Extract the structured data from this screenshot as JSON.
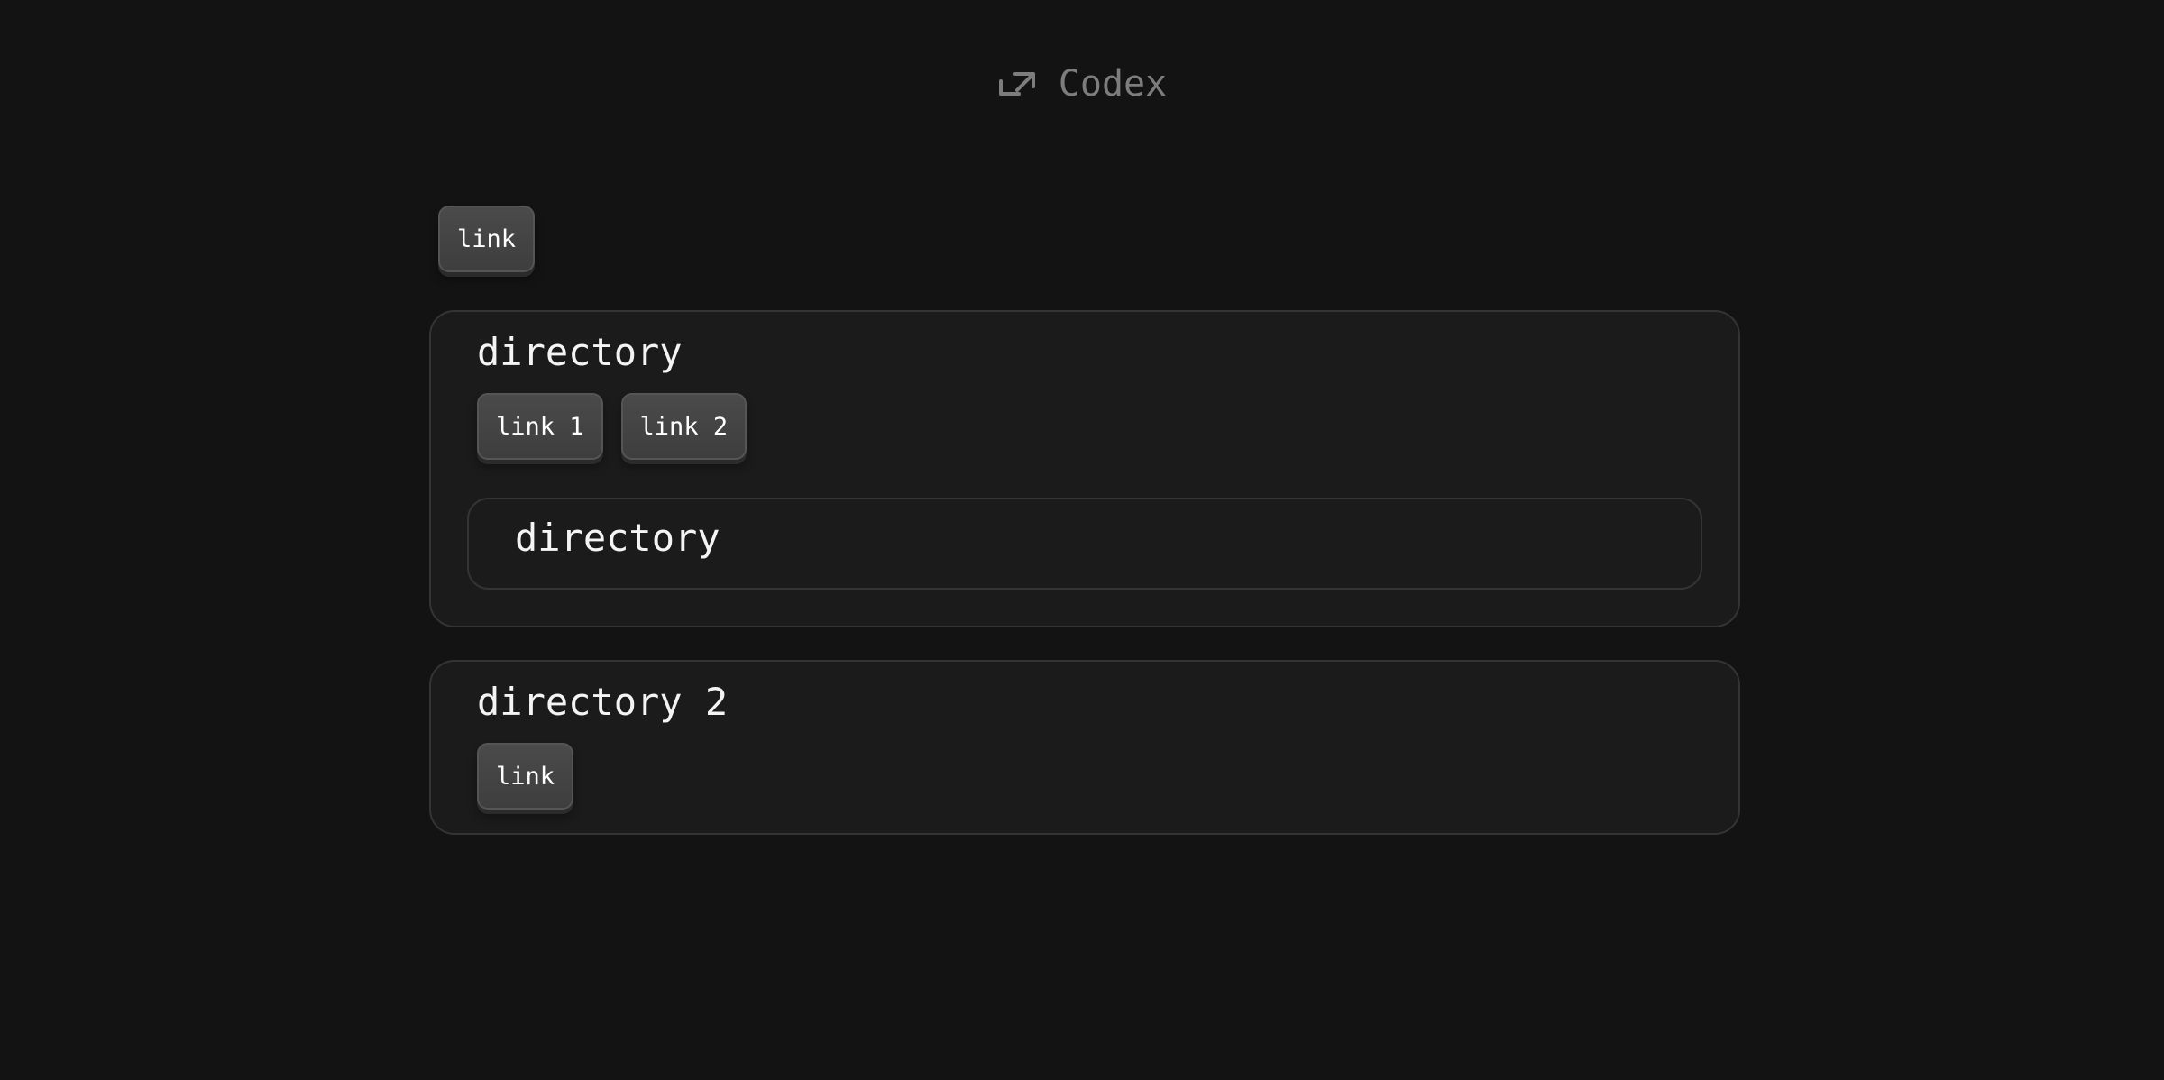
{
  "header": {
    "brand_name": "Codex",
    "brand_icon": "swap-arrows-icon"
  },
  "top_link": {
    "label": "link"
  },
  "directories": [
    {
      "title": "directory",
      "links": [
        "link 1",
        "link 2"
      ],
      "children": [
        {
          "title": "directory"
        }
      ]
    },
    {
      "title": "directory 2",
      "links": [
        "link"
      ]
    }
  ],
  "colors": {
    "background": "#131313",
    "card": "#1b1b1b",
    "card_border": "#343434",
    "button": "#454545",
    "brand_text": "#7d7d7d"
  }
}
